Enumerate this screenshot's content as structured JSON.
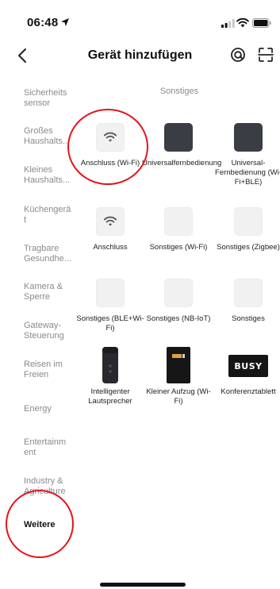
{
  "status_bar": {
    "time": "06:48"
  },
  "nav": {
    "title": "Gerät hinzufügen"
  },
  "sidebar": {
    "items": [
      {
        "label": "Sicherheits sensor"
      },
      {
        "label": "Großes Haushalts..."
      },
      {
        "label": "Kleines Haushalts..."
      },
      {
        "label": "Küchengerä t"
      },
      {
        "label": "Tragbare Gesundhe..."
      },
      {
        "label": "Kamera & Sperre"
      },
      {
        "label": "Gateway-Steuerung"
      },
      {
        "label": "Reisen im Freien"
      },
      {
        "label": "Energy"
      },
      {
        "label": "Entertainm ent"
      },
      {
        "label": "Industry & Agriculture"
      },
      {
        "label": "Weitere"
      }
    ]
  },
  "content": {
    "section_title": "Sonstiges",
    "devices": [
      {
        "label": "Anschluss (Wi-Fi)",
        "icon": "wifi-icon"
      },
      {
        "label": "Universalfernbedienung",
        "icon": "remote-icon"
      },
      {
        "label": "Universal-Fernbedienung (Wi-Fi+BLE)",
        "icon": "remote-icon"
      },
      {
        "label": "Anschluss",
        "icon": "wifi-icon"
      },
      {
        "label": "Sonstiges (Wi-Fi)",
        "icon": "generic-device-icon"
      },
      {
        "label": "Sonstiges (Zigbee)",
        "icon": "generic-device-icon"
      },
      {
        "label": "Sonstiges (BLE+Wi-Fi)",
        "icon": "generic-device-icon"
      },
      {
        "label": "Sonstiges (NB-IoT)",
        "icon": "generic-device-icon"
      },
      {
        "label": "Sonstiges",
        "icon": "generic-device-icon"
      },
      {
        "label": "Intelligenter Lautsprecher",
        "icon": "smart-speaker-icon"
      },
      {
        "label": "Kleiner Aufzug (Wi-Fi)",
        "icon": "elevator-icon"
      },
      {
        "label": "Konferenztablett",
        "icon": "busy-tablet-icon",
        "badge_text": "BUSY"
      }
    ]
  },
  "colors": {
    "active_text": "#111111",
    "inactive_text": "#8a8a8f",
    "annotation_red": "#e3141b",
    "dark_tile": "#3b3d44"
  }
}
